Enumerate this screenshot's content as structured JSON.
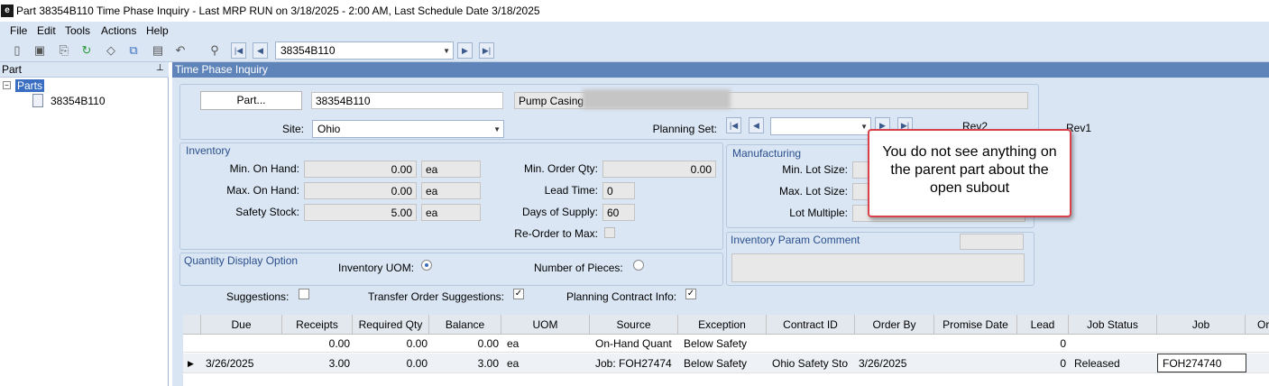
{
  "window": {
    "title": "Part 38354B110 Time Phase Inquiry  - Last MRP RUN on 3/18/2025 - 2:00 AM, Last Schedule Date  3/18/2025"
  },
  "menu": [
    "File",
    "Edit",
    "Tools",
    "Actions",
    "Help"
  ],
  "toolbar": {
    "part_value": "38354B110"
  },
  "left": {
    "header": "Part",
    "pin": "✉",
    "tree_root": "Parts",
    "tree_child": "38354B110"
  },
  "right": {
    "header": "Time Phase Inquiry"
  },
  "part": {
    "button": "Part...",
    "number": "38354B110",
    "description": "Pump Casing"
  },
  "site": {
    "label": "Site:",
    "value": "Ohio"
  },
  "planning_set": {
    "label": "Planning Set:"
  },
  "revs": {
    "rev2": "Rev2",
    "rev1": "Rev1"
  },
  "inventory": {
    "title": "Inventory",
    "min_on_hand": {
      "label": "Min. On Hand:",
      "value": "0.00",
      "uom": "ea"
    },
    "max_on_hand": {
      "label": "Max. On Hand:",
      "value": "0.00",
      "uom": "ea"
    },
    "safety_stock": {
      "label": "Safety Stock:",
      "value": "5.00",
      "uom": "ea"
    },
    "min_order_qty": {
      "label": "Min. Order Qty:",
      "value": "0.00"
    },
    "lead_time": {
      "label": "Lead Time:",
      "value": "0"
    },
    "days_of_supply": {
      "label": "Days of Supply:",
      "value": "60"
    },
    "reorder_to_max": {
      "label": "Re-Order to Max:"
    }
  },
  "manufacturing": {
    "title": "Manufacturing",
    "min_lot": "Min. Lot Size:",
    "max_lot": "Max. Lot Size:",
    "lot_multiple": "Lot Multiple:"
  },
  "comment": {
    "title": "Inventory Param Comment"
  },
  "qty_display": {
    "title": "Quantity Display Option",
    "inventory_uom": "Inventory UOM:",
    "pieces": "Number of Pieces:"
  },
  "options": {
    "suggestions": "Suggestions:",
    "transfer": "Transfer Order Suggestions:",
    "planning": "Planning Contract Info:",
    "check": "✓"
  },
  "grid": {
    "columns": [
      "Due",
      "Receipts",
      "Required Qty",
      "Balance",
      "UOM",
      "Source",
      "Exception",
      "Contract ID",
      "Order By",
      "Promise Date",
      "Lead",
      "Job Status",
      "Job",
      "Or"
    ],
    "rows": [
      [
        "",
        "0.00",
        "0.00",
        "0.00",
        "ea",
        "On-Hand Quant",
        "Below Safety",
        "",
        "",
        "",
        "0",
        "",
        "",
        ""
      ],
      [
        "3/26/2025",
        "3.00",
        "0.00",
        "3.00",
        "ea",
        "Job: FOH27474",
        "Below Safety",
        "Ohio Safety Sto",
        "3/26/2025",
        "",
        "0",
        "Released",
        "FOH274740",
        ""
      ]
    ],
    "row_marker": "▶"
  },
  "callout": {
    "text": "You do not see anything on the parent part about the open subout"
  }
}
